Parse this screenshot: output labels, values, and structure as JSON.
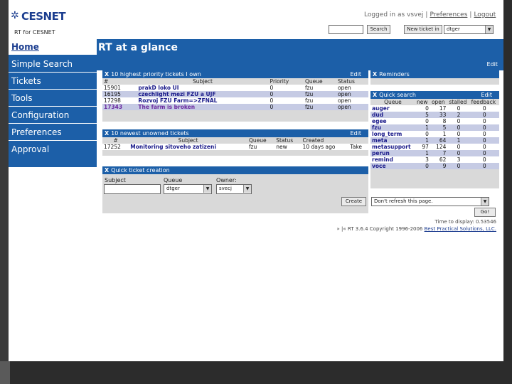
{
  "header": {
    "logo_text": "CESNET",
    "logo_sub": "RT for CESNET",
    "logged_in": "Logged in as vsvej",
    "preferences": "Preferences",
    "logout": "Logout",
    "search_button": "Search",
    "new_ticket_button": "New ticket in",
    "queue_select": "dtger"
  },
  "nav": {
    "home": "Home",
    "simple_search": "Simple Search",
    "tickets": "Tickets",
    "tools": "Tools",
    "configuration": "Configuration",
    "preferences": "Preferences",
    "approval": "Approval"
  },
  "page": {
    "title": "RT at a glance",
    "edit": "Edit"
  },
  "priority_box": {
    "title": "10 highest priority tickets I own",
    "edit": "Edit",
    "columns": [
      "#",
      "Subject",
      "Priority",
      "Queue",
      "Status"
    ],
    "rows": [
      [
        "15901",
        "prakD loko UI",
        "0",
        "fzu",
        "open"
      ],
      [
        "16195",
        "czechlight mezi FZU a UJF",
        "0",
        "fzu",
        "open"
      ],
      [
        "17298",
        "Rozvoj FZU Farm=>ZFNAL",
        "0",
        "fzu",
        "open"
      ],
      [
        "17343",
        "The farm is broken",
        "0",
        "fzu",
        "open"
      ]
    ]
  },
  "unowned_box": {
    "title": "10 newest unowned tickets",
    "edit": "Edit",
    "columns": [
      "#",
      "Subject",
      "Queue",
      "Status",
      "Created",
      ""
    ],
    "rows": [
      [
        "17252",
        "Monitoring sitoveho zatizeni",
        "fzu",
        "new",
        "10 days ago",
        "Take"
      ]
    ]
  },
  "quick_ticket": {
    "title": "Quick ticket creation",
    "subject_label": "Subject",
    "queue_label": "Queue",
    "owner_label": "Owner:",
    "queue_value": "dtger",
    "owner_value": "svecj",
    "create_button": "Create"
  },
  "reminders": {
    "title": "Reminders"
  },
  "quick_search": {
    "title": "Quick search",
    "edit": "Edit",
    "columns": [
      "Queue",
      "new",
      "open",
      "stalled",
      "feedback"
    ],
    "rows": [
      [
        "auger",
        "0",
        "17",
        "0",
        "0"
      ],
      [
        "dud",
        "5",
        "33",
        "2",
        "0"
      ],
      [
        "egee",
        "0",
        "8",
        "0",
        "0"
      ],
      [
        "fzu",
        "1",
        "5",
        "0",
        "0"
      ],
      [
        "long_term",
        "0",
        "1",
        "0",
        "0"
      ],
      [
        "meta",
        "1",
        "64",
        "1",
        "0"
      ],
      [
        "metasupport",
        "97",
        "124",
        "0",
        "0"
      ],
      [
        "perun",
        "1",
        "7",
        "0",
        "0"
      ],
      [
        "remind",
        "3",
        "62",
        "3",
        "0"
      ],
      [
        "voce",
        "0",
        "9",
        "0",
        "0"
      ]
    ]
  },
  "refresh": {
    "select_value": "Don't refresh this page.",
    "go_button": "Go!"
  },
  "footer": {
    "time": "Time to display: 0.53546",
    "copyright": "» |« RT 3.6.4 Copyright 1996-2006",
    "company": "Best Practical Solutions, LLC."
  }
}
